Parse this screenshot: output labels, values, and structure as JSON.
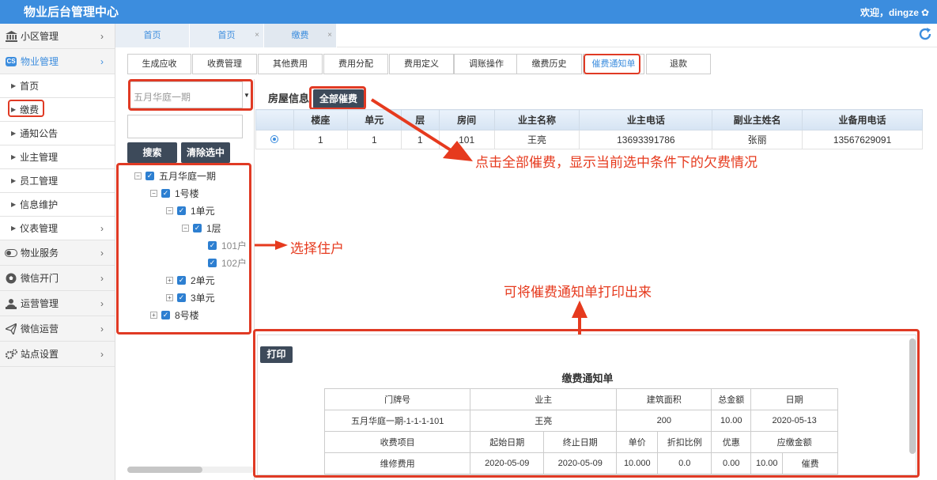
{
  "app": {
    "title": "物业后台管理中心",
    "welcome": "欢迎，dingze"
  },
  "sidebar": {
    "items": [
      {
        "label": "小区管理",
        "icon": "bank-icon"
      },
      {
        "label": "物业管理",
        "icon": "cs-icon",
        "badge": "CS"
      },
      {
        "label": "首页"
      },
      {
        "label": "缴费"
      },
      {
        "label": "通知公告"
      },
      {
        "label": "业主管理"
      },
      {
        "label": "员工管理"
      },
      {
        "label": "信息维护"
      },
      {
        "label": "仪表管理"
      },
      {
        "label": "物业服务",
        "icon": "toggle-icon"
      },
      {
        "label": "微信开门",
        "icon": "soccer-icon"
      },
      {
        "label": "运营管理",
        "icon": "person-icon"
      },
      {
        "label": "微信运营",
        "icon": "paper-plane-icon"
      },
      {
        "label": "站点设置",
        "icon": "gears-icon"
      }
    ]
  },
  "tabs": [
    {
      "label": "首页"
    },
    {
      "label": "首页"
    },
    {
      "label": "缴费"
    }
  ],
  "subnav": [
    "生成应收",
    "收费管理",
    "其他费用",
    "费用分配",
    "费用定义",
    "调账操作",
    "缴费历史",
    "催费通知单",
    "退款"
  ],
  "filter": {
    "community": "五月华庭一期",
    "search_label": "搜索",
    "clear_label": "清除选中"
  },
  "tree": {
    "root": "五月华庭一期",
    "building1": "1号楼",
    "unit1": "1单元",
    "floor1": "1层",
    "room101": "101户",
    "room102": "102户",
    "unit2": "2单元",
    "unit3": "3单元",
    "building8": "8号楼"
  },
  "house": {
    "title": "房屋信息",
    "all_btn": "全部催费",
    "columns": [
      "",
      "楼座",
      "单元",
      "层",
      "房间",
      "业主名称",
      "业主电话",
      "副业主姓名",
      "业备用电话"
    ],
    "row": [
      "1",
      "1",
      "1",
      "101",
      "王亮",
      "13693391786",
      "张丽",
      "13567629091"
    ]
  },
  "annotations": {
    "click_all": "点击全部催费，显示当前选中条件下的欠费情况",
    "select_resident": "选择住户",
    "print_note": "可将催费通知单打印出来"
  },
  "notice": {
    "print_btn": "打印",
    "title": "缴费通知单",
    "head1": [
      "门牌号",
      "业主",
      "建筑面积",
      "总金额",
      "日期"
    ],
    "row1": [
      "五月华庭一期-1-1-1-101",
      "王亮",
      "200",
      "10.00",
      "2020-05-13"
    ],
    "head2": [
      "收费项目",
      "起始日期",
      "终止日期",
      "单价",
      "折扣比例",
      "优惠",
      "应缴金额"
    ],
    "row2": [
      "维修费用",
      "2020-05-09",
      "2020-05-09",
      "10.000",
      "0.0",
      "0.00",
      "10.00"
    ],
    "pay_link": "催费"
  },
  "colors": {
    "primary": "#3c8dde",
    "annotation": "#e63a1e",
    "dark_button": "#3d4a5a"
  }
}
